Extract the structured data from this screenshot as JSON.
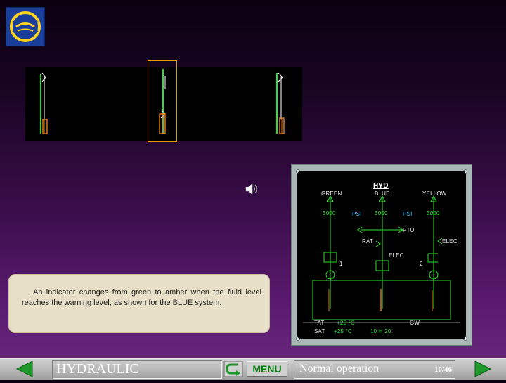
{
  "caption": {
    "text": "An indicator changes from green to amber when the fluid level reaches the warning level, as shown for the BLUE system."
  },
  "ecam": {
    "title": "HYD",
    "systems": [
      {
        "name": "GREEN",
        "pressure": "3000"
      },
      {
        "name": "BLUE",
        "pressure": "3000"
      },
      {
        "name": "YELLOW",
        "pressure": "3000"
      }
    ],
    "psi_label": "PSI",
    "ptu_label": "PTU",
    "rat_label": "RAT",
    "elec_label": "ELEC",
    "elec_pump_label": "ELEC",
    "pump_1": "1",
    "pump_2": "2",
    "tat": {
      "label": "TAT",
      "value": "+25 °C"
    },
    "sat": {
      "label": "SAT",
      "value": "+25 °C"
    },
    "gw": {
      "label": "GW",
      "value": ""
    },
    "time": "10 H 20"
  },
  "colors": {
    "indicator_green": "#2fe02f",
    "indicator_amber": "#e0781a",
    "selection_border": "#d8a000",
    "menu_text": "#0b7a16"
  },
  "nav": {
    "title": "HYDRAULIC",
    "menu_label": "MENU",
    "status": "Normal operation",
    "page": "10/46",
    "prev_icon": "triangle-left-icon",
    "next_icon": "triangle-right-icon",
    "return_icon": "return-arrow-icon"
  }
}
